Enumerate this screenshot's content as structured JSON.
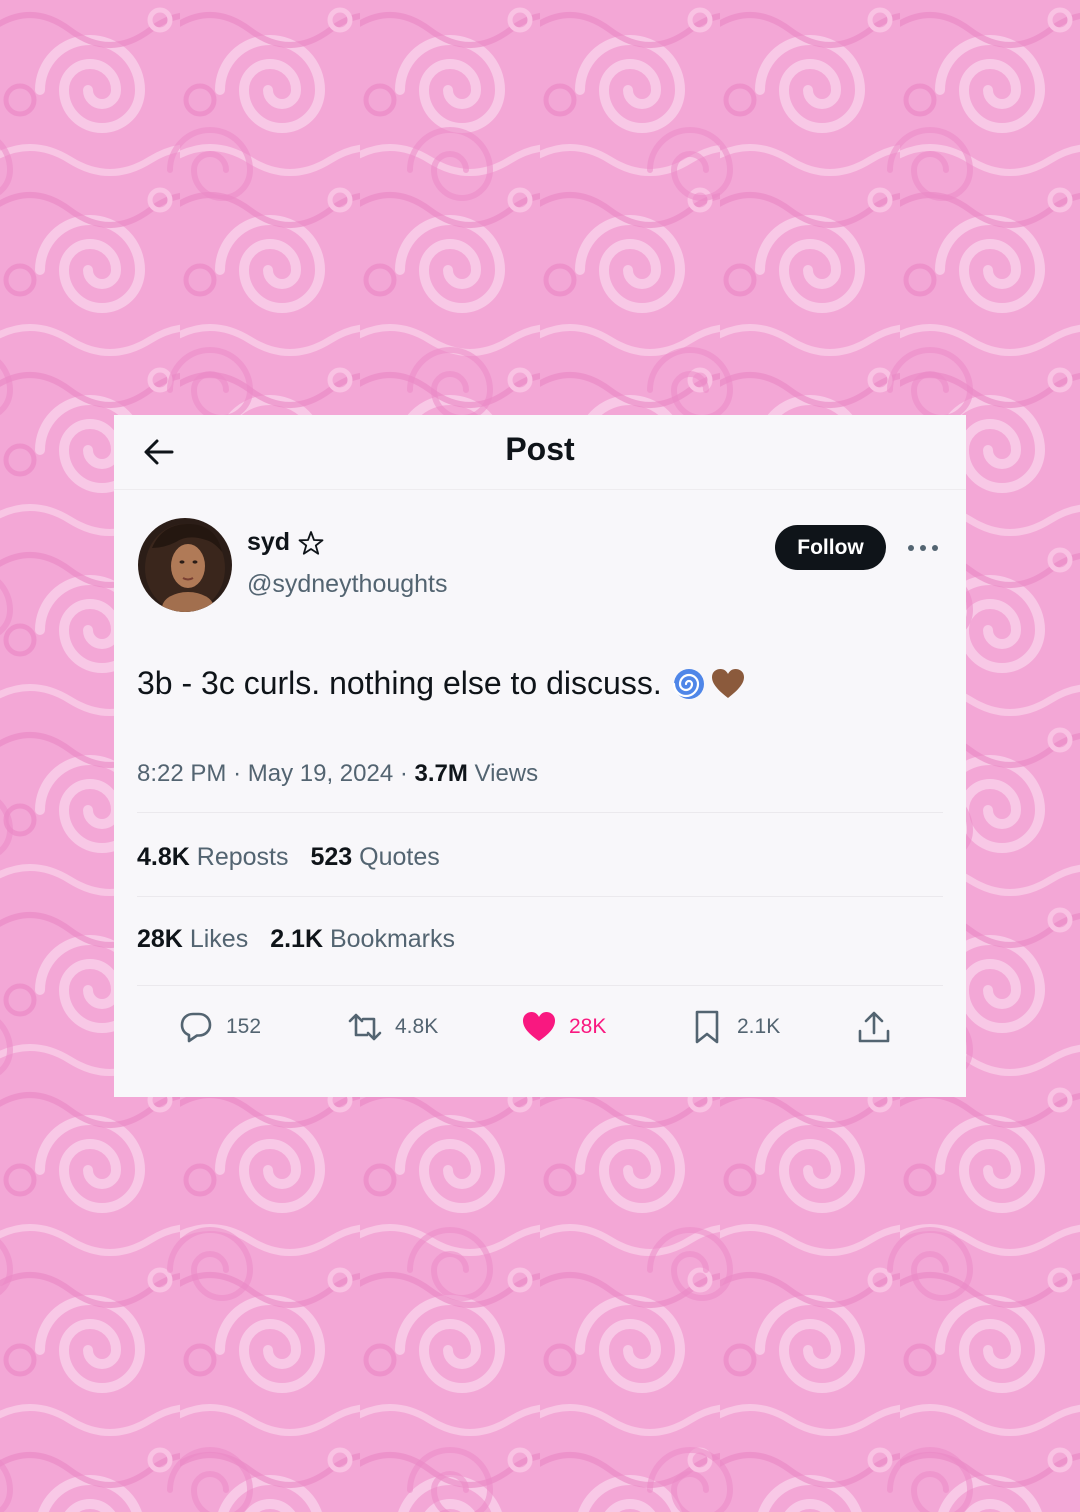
{
  "header": {
    "title": "Post"
  },
  "author": {
    "name": "syd",
    "handle": "@sydneythoughts"
  },
  "follow_label": "Follow",
  "tweet": {
    "text": "3b - 3c curls. nothing else to discuss.",
    "emojis": [
      "cyclone-emoji",
      "brown-heart-emoji"
    ]
  },
  "meta": {
    "time": "8:22 PM",
    "date": "May 19, 2024",
    "views_count": "3.7M",
    "views_label": "Views"
  },
  "stats": {
    "reposts_count": "4.8K",
    "reposts_label": "Reposts",
    "quotes_count": "523",
    "quotes_label": "Quotes",
    "likes_count": "28K",
    "likes_label": "Likes",
    "bookmarks_count": "2.1K",
    "bookmarks_label": "Bookmarks"
  },
  "actions": {
    "replies": "152",
    "reposts": "4.8K",
    "likes": "28K",
    "bookmarks": "2.1K"
  },
  "colors": {
    "background": "#f4a9d8",
    "card": "#f8f7fa",
    "like": "#f91880",
    "text_primary": "#0f1419",
    "text_secondary": "#536471"
  }
}
